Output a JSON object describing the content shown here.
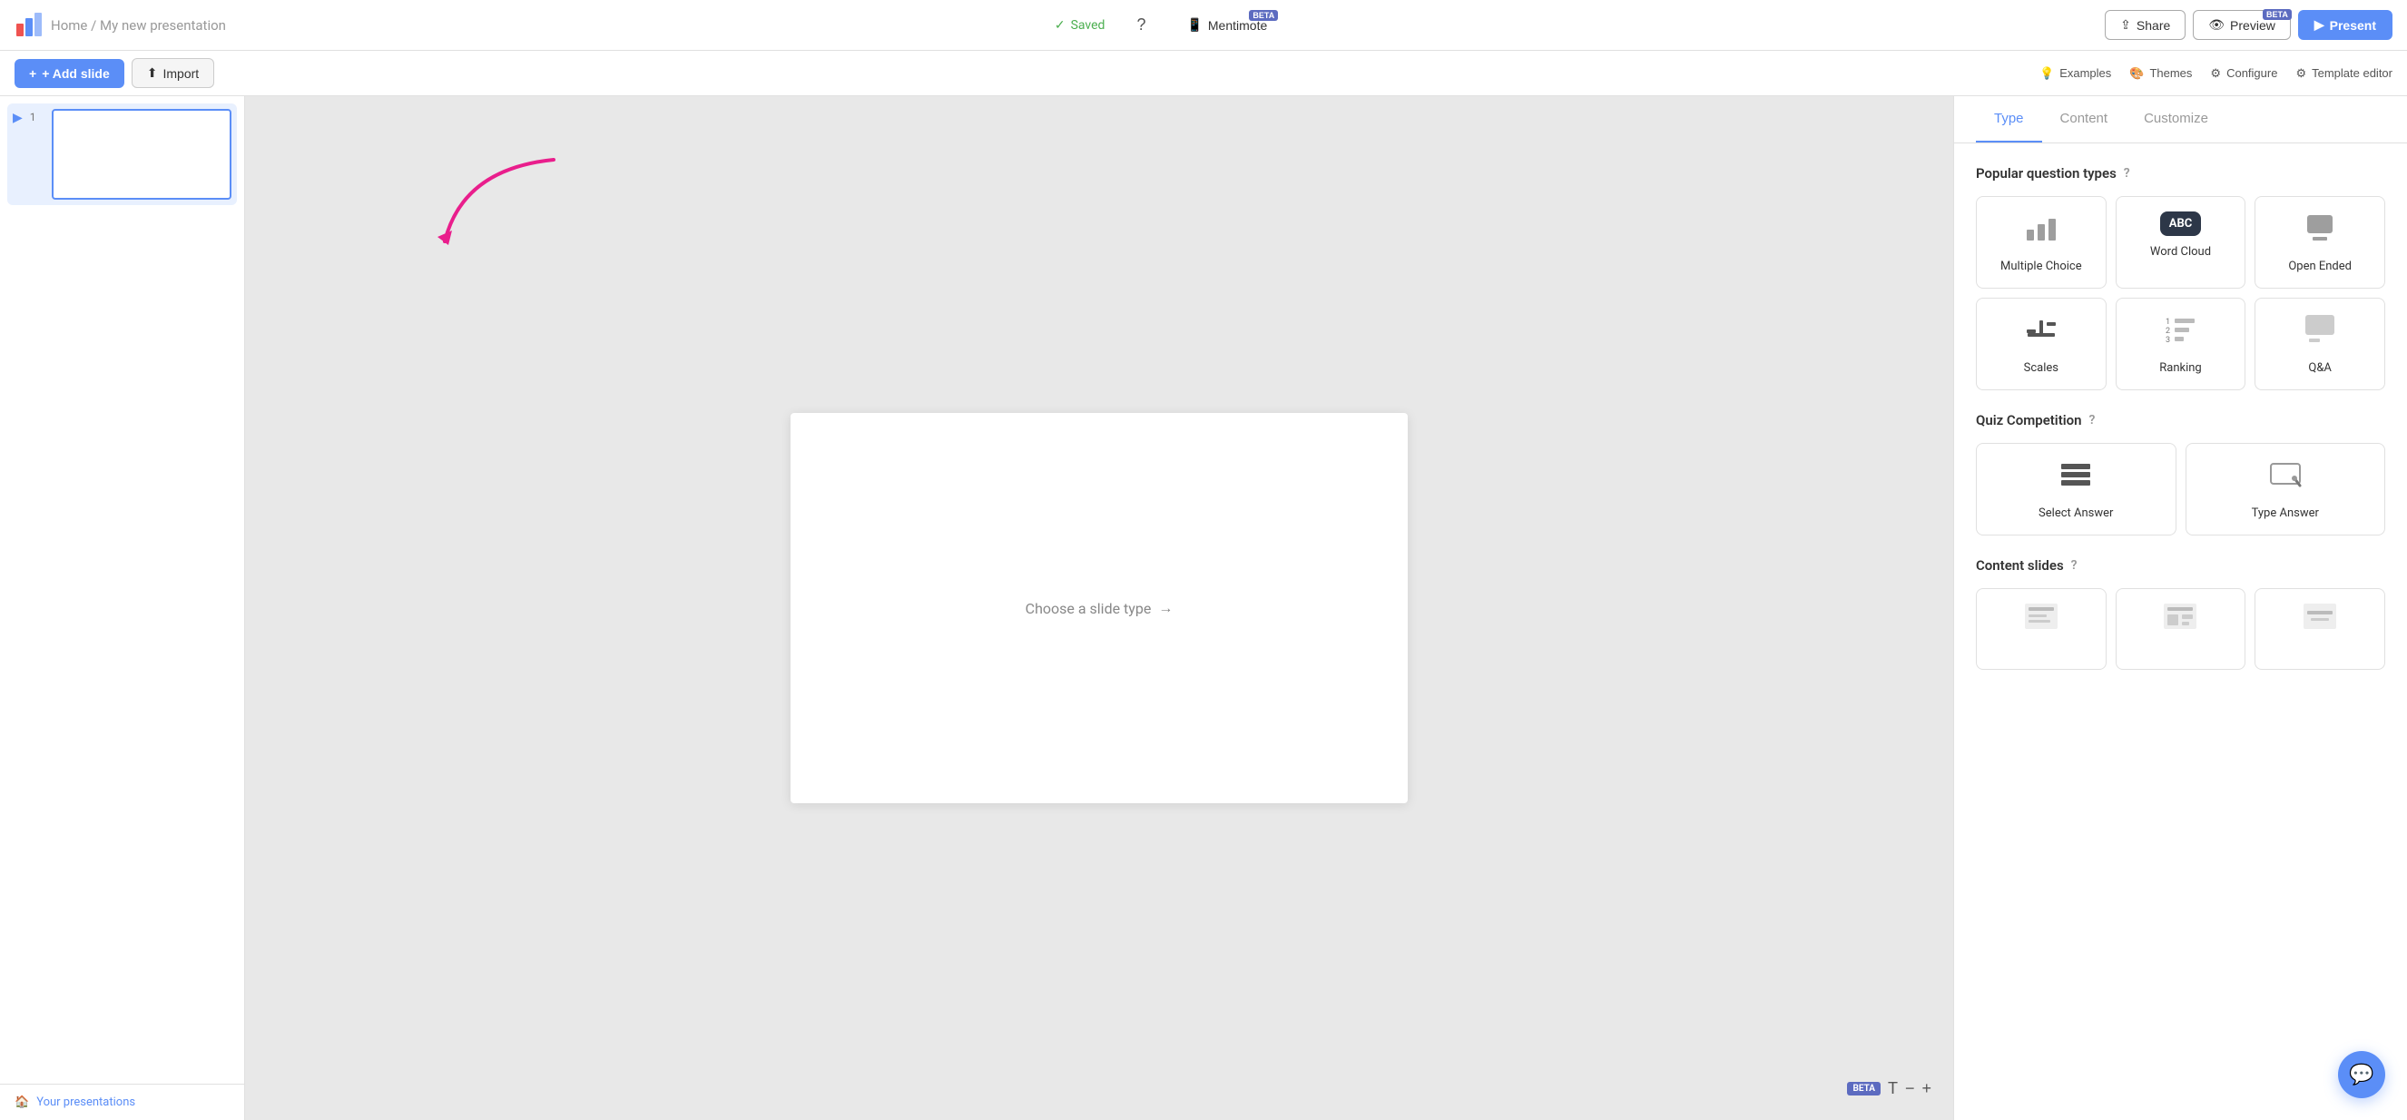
{
  "header": {
    "home_label": "Home",
    "separator": "/",
    "presentation_name": "My new presentation",
    "saved_label": "Saved",
    "help_icon": "?",
    "mentimote_label": "Mentimote",
    "mentimote_beta": "BETA",
    "share_label": "Share",
    "preview_label": "Preview",
    "preview_beta": "BETA",
    "present_label": "Present"
  },
  "toolbar": {
    "add_slide_label": "+ Add slide",
    "import_label": "Import",
    "examples_label": "Examples",
    "themes_label": "Themes",
    "configure_label": "Configure",
    "template_editor_label": "Template editor"
  },
  "sidebar": {
    "slide_number": "1",
    "your_presentations_label": "Your presentations"
  },
  "canvas": {
    "choose_slide_text": "Choose a slide type",
    "arrow_label": "→",
    "beta_label": "BETA",
    "zoom_in": "+",
    "zoom_out": "−"
  },
  "right_panel": {
    "tabs": [
      {
        "id": "type",
        "label": "Type"
      },
      {
        "id": "content",
        "label": "Content"
      },
      {
        "id": "customize",
        "label": "Customize"
      }
    ],
    "active_tab": "type",
    "popular_section": {
      "title": "Popular question types",
      "items": [
        {
          "id": "multiple-choice",
          "label": "Multiple Choice"
        },
        {
          "id": "word-cloud",
          "label": "Word Cloud"
        },
        {
          "id": "open-ended",
          "label": "Open Ended"
        },
        {
          "id": "scales",
          "label": "Scales"
        },
        {
          "id": "ranking",
          "label": "Ranking"
        },
        {
          "id": "qa",
          "label": "Q&A"
        }
      ]
    },
    "quiz_section": {
      "title": "Quiz Competition",
      "items": [
        {
          "id": "select-answer",
          "label": "Select Answer"
        },
        {
          "id": "type-answer",
          "label": "Type Answer"
        }
      ]
    },
    "content_section": {
      "title": "Content slides",
      "items": [
        {
          "id": "content-1",
          "label": ""
        },
        {
          "id": "content-2",
          "label": ""
        },
        {
          "id": "content-3",
          "label": ""
        }
      ]
    }
  },
  "colors": {
    "accent": "#5b8ef7",
    "dark": "#2d3748",
    "success": "#4caf50",
    "beta_bg": "#5c6bc0",
    "arrow_color": "#e91e8c"
  }
}
